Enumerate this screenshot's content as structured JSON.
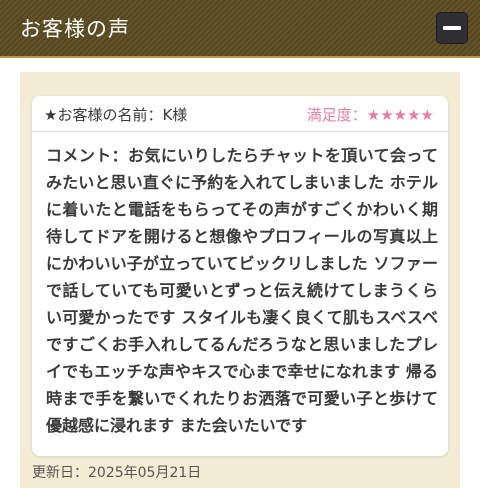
{
  "header": {
    "title": "お客様の声"
  },
  "review": {
    "customer_name": "★お客様の名前：K様",
    "satisfaction": "満足度：★★★★★",
    "comment": "コメント：お気にいりしたらチャットを頂いて会ってみたいと思い直ぐに予約を入れてしまいました ホテルに着いたと電話をもらってその声がすごくかわいく期待してドアを開けると想像やプロフィールの写真以上にかわいい子が立っていてビックリしました ソファーで話していても可愛いとずっと伝え続けてしまうくらい可愛かったです スタイルも凄く良くて肌もスベスベですごくお手入れしてるんだろうなと思いましたプレイでもエッチな声やキスで心まで幸せになれます 帰る時まで手を繋いでくれたりお洒落で可愛い子と歩けて優越感に浸れます また会いたいです",
    "updated": "更新日：2025年05月21日"
  },
  "colors": {
    "header_bg": "#5a4a21",
    "content_bg": "#f3ecd5",
    "accent_pink": "#e77da0"
  }
}
